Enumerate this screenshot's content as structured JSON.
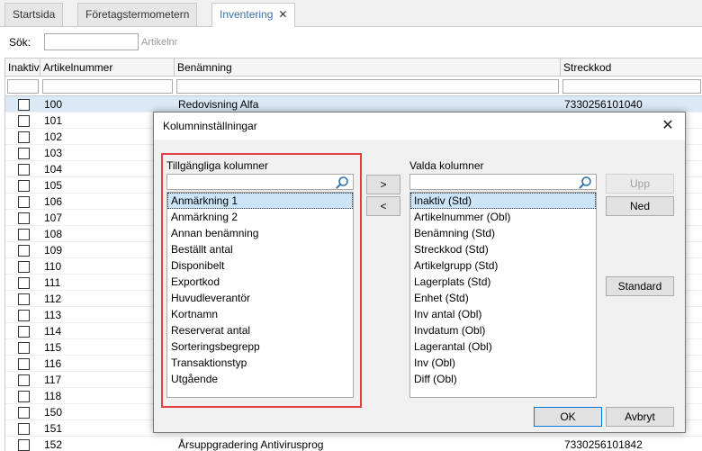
{
  "tabs": [
    {
      "label": "Startsida",
      "active": false
    },
    {
      "label": "Företagstermometern",
      "active": false
    },
    {
      "label": "Inventering",
      "active": true
    }
  ],
  "search": {
    "label": "Sök:",
    "value": "",
    "hint": "Artikelnr"
  },
  "grid": {
    "columns": [
      "Inaktiv",
      "Artikelnummer",
      "Benämning",
      "Streckkod"
    ],
    "rows": [
      {
        "artikelnummer": "100",
        "benamning": "Redovisning Alfa",
        "streckkod": "7330256101040",
        "selected": true
      },
      {
        "artikelnummer": "101",
        "benamning": "",
        "streckkod": ""
      },
      {
        "artikelnummer": "102",
        "benamning": "",
        "streckkod": ""
      },
      {
        "artikelnummer": "103",
        "benamning": "",
        "streckkod": ""
      },
      {
        "artikelnummer": "104",
        "benamning": "",
        "streckkod": ""
      },
      {
        "artikelnummer": "105",
        "benamning": "",
        "streckkod": ""
      },
      {
        "artikelnummer": "106",
        "benamning": "",
        "streckkod": ""
      },
      {
        "artikelnummer": "107",
        "benamning": "",
        "streckkod": ""
      },
      {
        "artikelnummer": "108",
        "benamning": "",
        "streckkod": ""
      },
      {
        "artikelnummer": "109",
        "benamning": "",
        "streckkod": ""
      },
      {
        "artikelnummer": "110",
        "benamning": "",
        "streckkod": ""
      },
      {
        "artikelnummer": "111",
        "benamning": "",
        "streckkod": ""
      },
      {
        "artikelnummer": "112",
        "benamning": "",
        "streckkod": ""
      },
      {
        "artikelnummer": "113",
        "benamning": "",
        "streckkod": ""
      },
      {
        "artikelnummer": "114",
        "benamning": "",
        "streckkod": ""
      },
      {
        "artikelnummer": "115",
        "benamning": "",
        "streckkod": ""
      },
      {
        "artikelnummer": "116",
        "benamning": "",
        "streckkod": ""
      },
      {
        "artikelnummer": "117",
        "benamning": "",
        "streckkod": ""
      },
      {
        "artikelnummer": "118",
        "benamning": "",
        "streckkod": ""
      },
      {
        "artikelnummer": "150",
        "benamning": "",
        "streckkod": ""
      },
      {
        "artikelnummer": "151",
        "benamning": "",
        "streckkod": ""
      },
      {
        "artikelnummer": "152",
        "benamning": "Årsuppgradering Antivirusprog",
        "streckkod": "7330256101842"
      }
    ]
  },
  "dialog": {
    "title": "Kolumninställningar",
    "available_title": "Tillgängliga kolumner",
    "available": [
      "Anmärkning 1",
      "Anmärkning 2",
      "Annan benämning",
      "Beställt antal",
      "Disponibelt",
      "Exportkod",
      "Huvudleverantör",
      "Kortnamn",
      "Reserverat antal",
      "Sorteringsbegrepp",
      "Transaktionstyp",
      "Utgående"
    ],
    "selected_title": "Valda kolumner",
    "selected": [
      "Inaktiv (Std)",
      "Artikelnummer (Obl)",
      "Benämning (Std)",
      "Streckkod (Std)",
      "Artikelgrupp (Std)",
      "Lagerplats (Std)",
      "Enhet (Std)",
      "Inv antal (Obl)",
      "Invdatum (Obl)",
      "Lagerantal (Obl)",
      "Inv (Obl)",
      "Diff (Obl)"
    ],
    "buttons": {
      "add": ">",
      "remove": "<",
      "up": "Upp",
      "down": "Ned",
      "standard": "Standard",
      "ok": "OK",
      "cancel": "Avbryt"
    }
  },
  "colors": {
    "highlight": "#e0403f",
    "selection": "#cce4f7",
    "accent": "#0078d7"
  }
}
